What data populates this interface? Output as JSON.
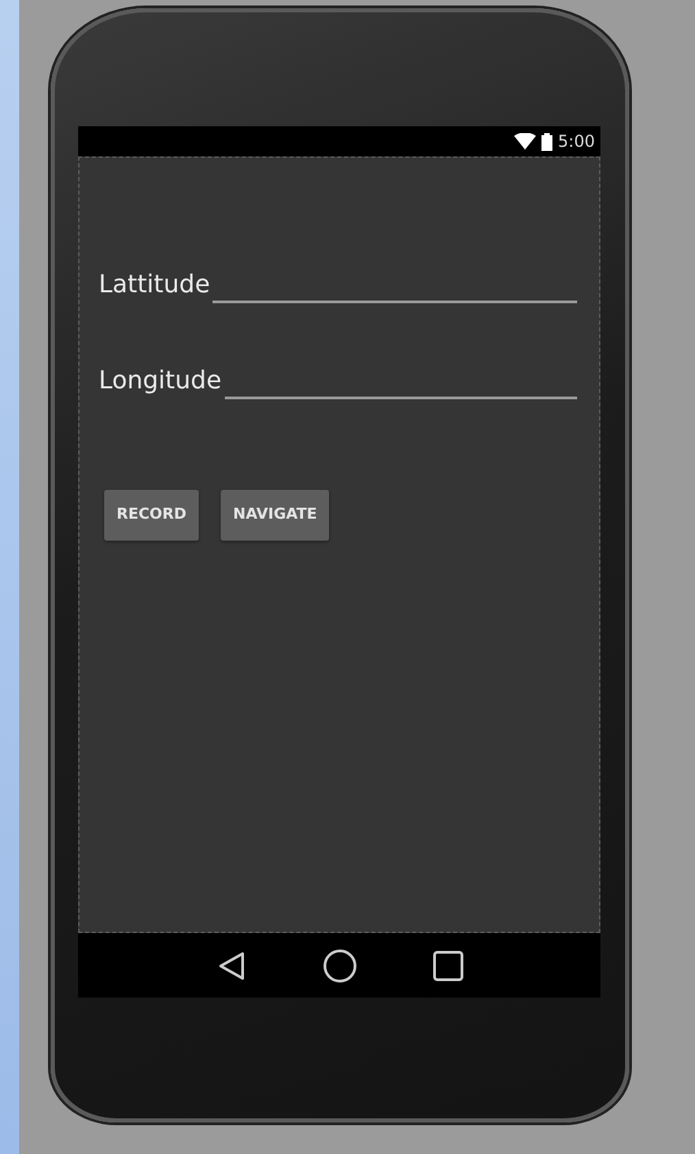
{
  "status_bar": {
    "time": "5:00"
  },
  "fields": [
    {
      "label": "Lattitude"
    },
    {
      "label": "Longitude"
    }
  ],
  "buttons": [
    "RECORD",
    "NAVIGATE"
  ]
}
